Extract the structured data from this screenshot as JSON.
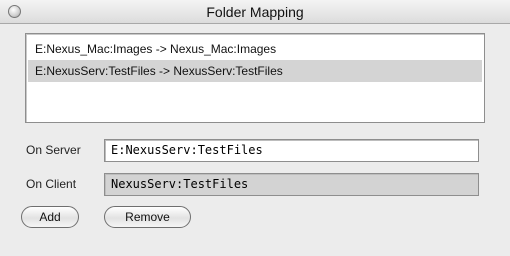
{
  "window": {
    "title": "Folder Mapping"
  },
  "mappings": [
    {
      "label": "E:Nexus_Mac:Images -> Nexus_Mac:Images",
      "selected": false
    },
    {
      "label": "E:NexusServ:TestFiles -> NexusServ:TestFiles",
      "selected": true
    }
  ],
  "form": {
    "server_label": "On Server",
    "server_value": "E:NexusServ:TestFiles",
    "client_label": "On Client",
    "client_value": "NexusServ:TestFiles"
  },
  "buttons": {
    "add": "Add",
    "remove": "Remove"
  }
}
